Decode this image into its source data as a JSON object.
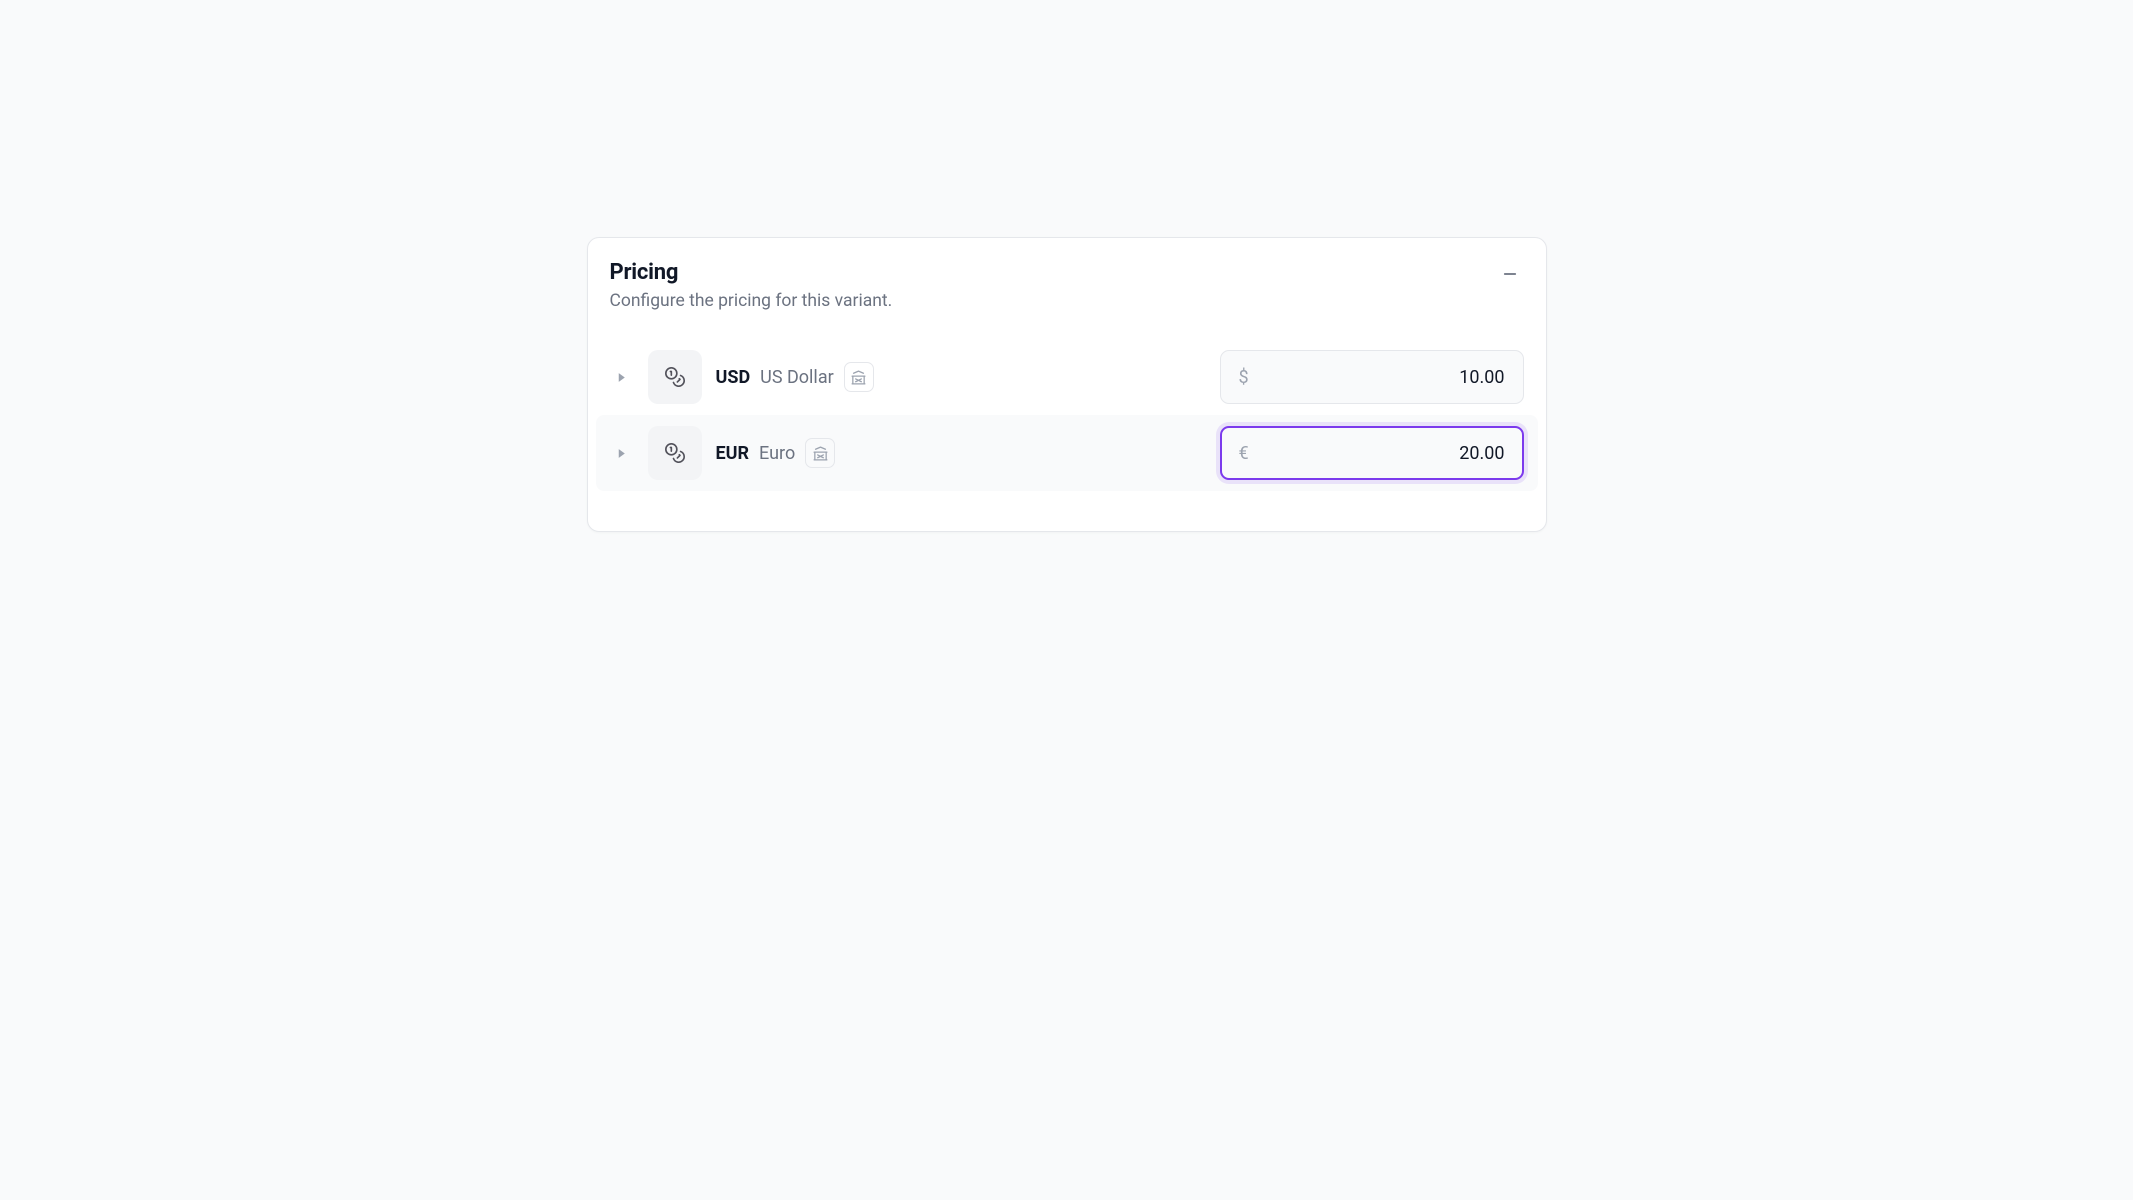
{
  "card": {
    "title": "Pricing",
    "subtitle": "Configure the pricing for this variant."
  },
  "rows": [
    {
      "code": "USD",
      "name": "US Dollar",
      "symbol": "$",
      "value": "10.00",
      "focused": false
    },
    {
      "code": "EUR",
      "name": "Euro",
      "symbol": "€",
      "value": "20.00",
      "focused": true
    }
  ]
}
